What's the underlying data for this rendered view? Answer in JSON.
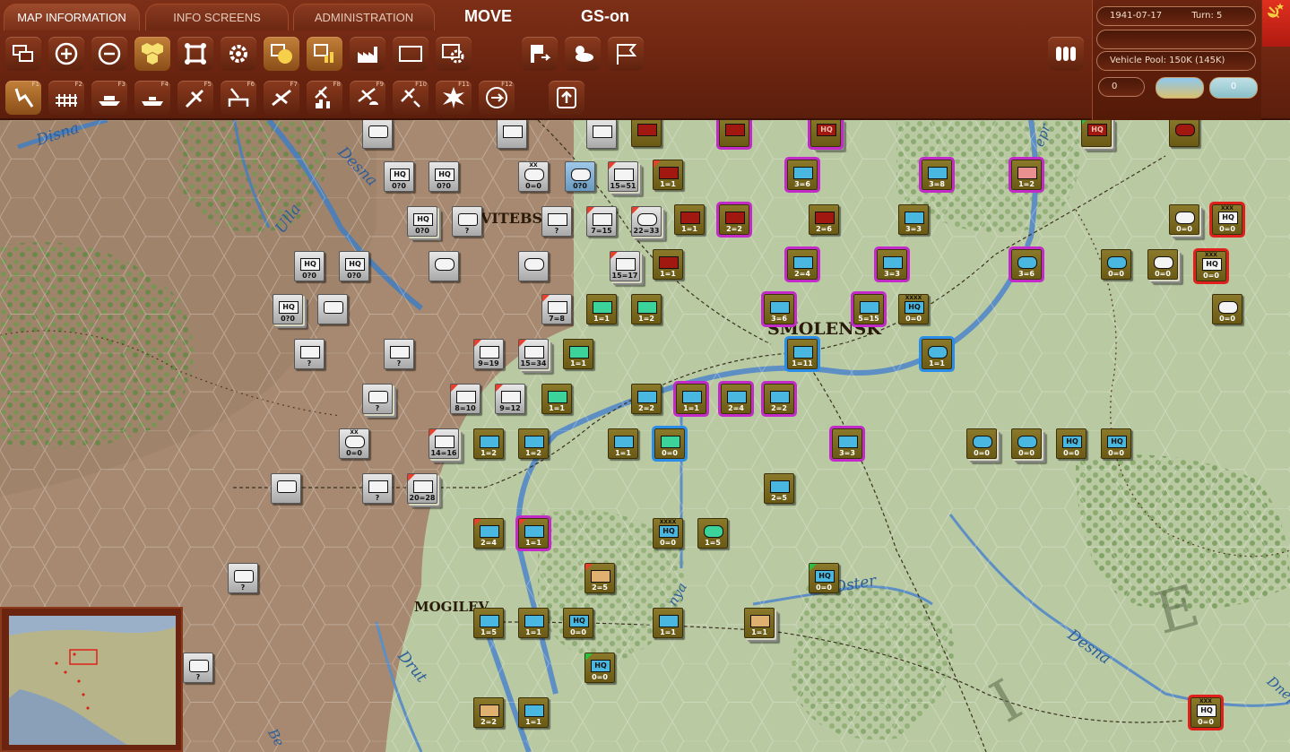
{
  "tabs": [
    {
      "label": "MAP INFORMATION",
      "active": true
    },
    {
      "label": "INFO SCREENS",
      "active": false
    },
    {
      "label": "ADMINISTRATION",
      "active": false
    }
  ],
  "mode": {
    "phase": "MOVE",
    "gs": "GS-on"
  },
  "status": {
    "date": "1941-07-17",
    "turn_label": "Turn: 5",
    "blank_field": "",
    "vehicle_pool": "Vehicle Pool: 150K (145K)",
    "counter_value": "0",
    "counter_value2": "0"
  },
  "toolbar_row1_icons": [
    "stack-toggle-icon",
    "zoom-in-icon",
    "zoom-out-icon",
    "hex-overlay-icon",
    "unit-view-icon",
    "settings-gear-icon",
    "counter-mode-icon",
    "chart-icon",
    "factory-icon",
    "frame-icon",
    "camera-icon",
    "exit-flag-icon",
    "weather-icon",
    "flag-icon",
    "unit-list-icon"
  ],
  "toolbar_row2": [
    {
      "key": "F1",
      "icon": "move-icon"
    },
    {
      "key": "F2",
      "icon": "rail-icon"
    },
    {
      "key": "F3",
      "icon": "naval-icon"
    },
    {
      "key": "F4",
      "icon": "ship-icon"
    },
    {
      "key": "F5",
      "icon": "air-recon-icon"
    },
    {
      "key": "F6",
      "icon": "air-transfer-icon"
    },
    {
      "key": "F7",
      "icon": "air-drop-icon"
    },
    {
      "key": "F8",
      "icon": "bomb-city-icon"
    },
    {
      "key": "F9",
      "icon": "paradrop-icon"
    },
    {
      "key": "F10",
      "icon": "air-attack-icon"
    },
    {
      "key": "F11",
      "icon": "explosion-icon"
    },
    {
      "key": "F12",
      "icon": "air-strike-icon"
    }
  ],
  "cities": [
    "VITEBS",
    "SMOLENSK",
    "MOGILEV"
  ],
  "rivers": [
    "Disna",
    "Desna",
    "Ulla",
    "Oster",
    "Drut",
    "Desna",
    "Be",
    "epr",
    "Dnepr",
    "nya"
  ],
  "map_letters": [
    "E",
    "I"
  ],
  "units": [
    {
      "str": "0=0",
      "sz": "XX",
      "kind": "inf",
      "side": "axis"
    },
    {
      "str": "0?0",
      "sz": "",
      "kind": "hq",
      "side": "axis"
    },
    {
      "str": "?",
      "sz": "",
      "kind": "inf",
      "side": "axis"
    },
    {
      "str": "15=51",
      "sz": "XX",
      "kind": "inf",
      "side": "axis"
    },
    {
      "str": "7=15",
      "sz": "XX",
      "kind": "inf",
      "side": "axis"
    },
    {
      "str": "22=33",
      "sz": "XX",
      "kind": "inf",
      "side": "axis"
    },
    {
      "str": "15=17",
      "sz": "XX",
      "kind": "inf",
      "side": "axis"
    },
    {
      "str": "7=8",
      "sz": "XX",
      "kind": "inf",
      "side": "axis"
    },
    {
      "str": "9=19",
      "sz": "XX",
      "kind": "inf",
      "side": "axis"
    },
    {
      "str": "15=34",
      "sz": "XX",
      "kind": "inf",
      "side": "axis"
    },
    {
      "str": "8=10",
      "sz": "XX",
      "kind": "inf",
      "side": "axis"
    },
    {
      "str": "9=12",
      "sz": "XX",
      "kind": "inf",
      "side": "axis"
    },
    {
      "str": "14=16",
      "sz": "XX",
      "kind": "inf",
      "side": "axis"
    },
    {
      "str": "20=28",
      "sz": "XX",
      "kind": "inf",
      "side": "axis"
    },
    {
      "str": "1=1",
      "sz": "XX",
      "kind": "inf",
      "side": "soviet"
    },
    {
      "str": "2=2",
      "sz": "XX",
      "kind": "inf",
      "side": "soviet"
    },
    {
      "str": "2=6",
      "sz": "XX",
      "kind": "inf",
      "side": "soviet"
    },
    {
      "str": "3=6",
      "sz": "XX",
      "kind": "inf",
      "side": "soviet"
    },
    {
      "str": "3=8",
      "sz": "XX",
      "kind": "inf",
      "side": "soviet"
    },
    {
      "str": "1=2",
      "sz": "XX",
      "kind": "inf",
      "side": "soviet"
    },
    {
      "str": "3=3",
      "sz": "XX",
      "kind": "inf",
      "side": "soviet"
    },
    {
      "str": "2=4",
      "sz": "XX",
      "kind": "inf",
      "side": "soviet"
    },
    {
      "str": "5=15",
      "sz": "XX",
      "kind": "inf",
      "side": "soviet"
    },
    {
      "str": "1=11",
      "sz": "XX",
      "kind": "inf",
      "side": "soviet"
    },
    {
      "str": "2=5",
      "sz": "XX",
      "kind": "inf",
      "side": "soviet"
    },
    {
      "str": "1=5",
      "sz": "XX",
      "kind": "inf",
      "side": "soviet"
    },
    {
      "str": "0=0",
      "sz": "XXX",
      "kind": "hq",
      "side": "soviet"
    },
    {
      "str": "0=0",
      "sz": "XXXX",
      "kind": "hq",
      "side": "soviet"
    }
  ],
  "minimap": {
    "label": ""
  }
}
